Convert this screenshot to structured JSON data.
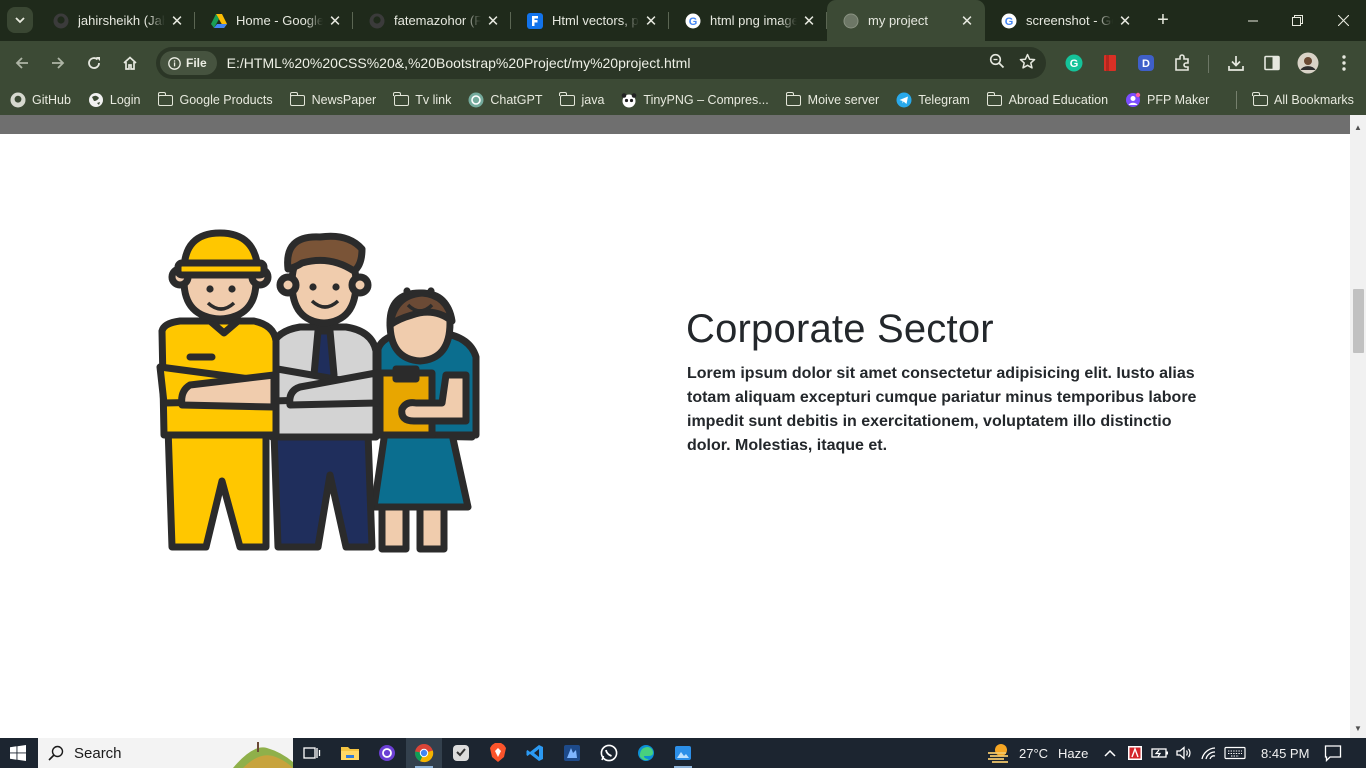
{
  "browser": {
    "tabs": [
      {
        "title": "jahirsheikh (Jahir",
        "icon": "github-icon",
        "active": false
      },
      {
        "title": "Home - Google",
        "icon": "google-drive-icon",
        "active": false
      },
      {
        "title": "fatemazohor (Fa",
        "icon": "github-icon",
        "active": false
      },
      {
        "title": "Html vectors, ph",
        "icon": "freepik-icon",
        "active": false
      },
      {
        "title": "html png image",
        "icon": "google-icon",
        "active": false
      },
      {
        "title": "my project",
        "icon": "globe-icon",
        "active": true
      },
      {
        "title": "screenshot - Go",
        "icon": "google-icon",
        "active": false
      }
    ],
    "address": {
      "chip_label": "File",
      "url": "E:/HTML%20%20CSS%20&,%20Bootstrap%20Project/my%20project.html"
    },
    "bookmarks": [
      {
        "label": "GitHub",
        "icon": "github-icon"
      },
      {
        "label": "Login",
        "icon": "globe-icon"
      },
      {
        "label": "Google Products",
        "icon": "folder-icon"
      },
      {
        "label": "NewsPaper",
        "icon": "folder-icon"
      },
      {
        "label": "Tv link",
        "icon": "folder-icon"
      },
      {
        "label": "ChatGPT",
        "icon": "chatgpt-icon"
      },
      {
        "label": "java",
        "icon": "folder-icon"
      },
      {
        "label": "TinyPNG – Compres...",
        "icon": "panda-icon"
      },
      {
        "label": "Moive server",
        "icon": "folder-icon"
      },
      {
        "label": "Telegram",
        "icon": "telegram-icon"
      },
      {
        "label": "Abroad Education",
        "icon": "folder-icon"
      },
      {
        "label": "PFP Maker",
        "icon": "pfp-icon"
      }
    ],
    "all_bookmarks_label": "All Bookmarks"
  },
  "page": {
    "heading": "Corporate Sector",
    "paragraph": "Lorem ipsum dolor sit amet consectetur adipisicing elit. Iusto alias totam aliquam excepturi cumque pariatur minus temporibus labore impedit sunt debitis in exercitationem, voluptatem illo distinctio dolor. Molestias, itaque et.",
    "illustration": "three-office-workers-illustration"
  },
  "taskbar": {
    "search_placeholder": "Search",
    "weather": {
      "temp": "27°C",
      "condition": "Haze"
    },
    "time": "8:45 PM"
  },
  "colors": {
    "tab_strip": "#1f2a1b",
    "toolbar": "#3c4a35",
    "heading_text": "#23272b",
    "worker_yellow": "#ffc700",
    "worker_navy": "#1f2e5c",
    "worker_teal": "#0b6e8f",
    "skin": "#f0ccad",
    "hair_brown": "#6b4a35"
  }
}
